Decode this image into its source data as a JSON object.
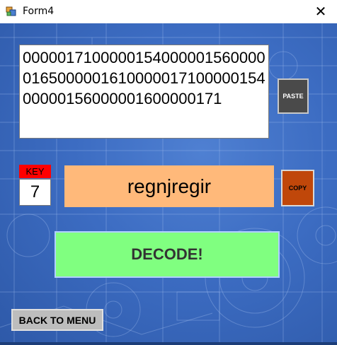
{
  "window": {
    "title": "Form4",
    "close_glyph": "✕"
  },
  "cipher_text": "0000017100000154000001560000016500000161000001710000015400000156000001600000171",
  "paste_button": "PASTE",
  "key": {
    "label": "KEY",
    "value": "7"
  },
  "output_text": "regnjregir",
  "copy_button": "COPY",
  "decode_button": "DECODE!",
  "back_button": "BACK TO MENU",
  "colors": {
    "background": "#3c6cc2",
    "key_label": "#ff0000",
    "output": "#ffb97a",
    "copy": "#c0470a",
    "decode": "#80ff80",
    "paste": "#4a4a4a"
  },
  "icons": {
    "app": "form-app-icon",
    "close": "close-icon"
  }
}
